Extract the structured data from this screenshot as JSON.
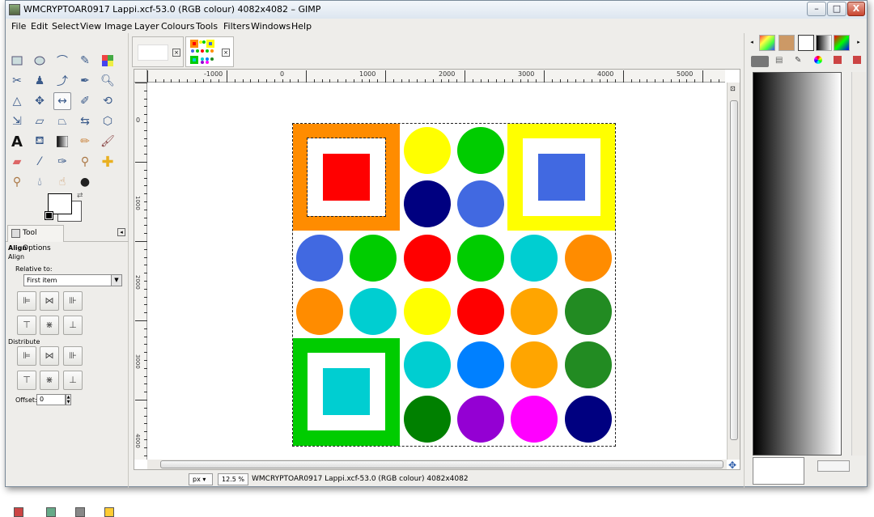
{
  "window": {
    "title": "WMCRYPTOAR0917 Lappi.xcf-53.0 (RGB colour) 4082x4082 – GIMP",
    "min": "–",
    "max": "□",
    "close": "X"
  },
  "menu": [
    "File",
    "Edit",
    "Select",
    "View",
    "Image",
    "Layer",
    "Colours",
    "Tools",
    "Filters",
    "Windows",
    "Help"
  ],
  "tool_options": {
    "tab": "Tool Options",
    "heading": "Align",
    "subheading": "Align",
    "relative_to_label": "Relative to:",
    "relative_to_value": "First item",
    "distribute_label": "Distribute",
    "offset_label": "Offset:",
    "offset_value": "0"
  },
  "rulers": {
    "h": [
      "-1000",
      "0",
      "1000",
      "2000",
      "3000",
      "4000",
      "5000"
    ],
    "v": [
      "0",
      "1000",
      "2000",
      "3000",
      "4000"
    ]
  },
  "status": {
    "unit": "px",
    "zoom": "12.5 %",
    "text": "WMCRYPTOAR0917 Lappi.xcf-53.0 (RGB colour) 4082x4082"
  },
  "image": {
    "squares": [
      {
        "outer": "#ff8c00",
        "inner": "#ff0000"
      },
      {
        "outer": "#ffff00",
        "inner": "#4169e1"
      },
      {
        "outer": "#00cc00",
        "inner": "#00ced1"
      }
    ],
    "circles": [
      [
        "#ffff00",
        "#00cc00"
      ],
      [
        "#000080",
        "#4169e1"
      ],
      [
        "#4169e1",
        "#00cc00",
        "#ff0000",
        "#00cc00",
        "#00ced1",
        "#ff8c00"
      ],
      [
        "#ff8c00",
        "#00ced1",
        "#ffff00",
        "#ff0000",
        "#ffa500",
        "#228b22"
      ],
      [
        "#00ced1",
        "#0080ff",
        "#ffa500",
        "#228b22"
      ],
      [
        "#008000",
        "#9400d3",
        "#ff00ff",
        "#000080"
      ]
    ]
  }
}
